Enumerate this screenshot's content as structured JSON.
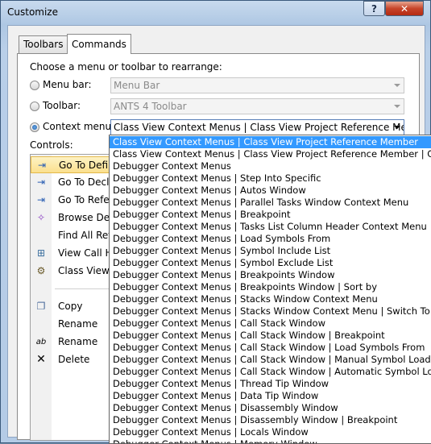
{
  "window": {
    "title": "Customize",
    "help_label": "?",
    "close_label": "✕"
  },
  "tabs": [
    {
      "label": "Toolbars"
    },
    {
      "label": "Commands"
    }
  ],
  "prompt": "Choose a menu or toolbar to rearrange:",
  "options": {
    "menu_bar": {
      "label": "Menu bar:",
      "value": "Menu Bar",
      "selected": false
    },
    "toolbar": {
      "label": "Toolbar:",
      "value": "ANTS 4 Toolbar",
      "selected": false
    },
    "context_menu": {
      "label": "Context menu:",
      "value": "Class View Context Menus | Class View Project Reference Membe",
      "selected": true
    }
  },
  "controls_label": "Controls:",
  "controls": [
    {
      "icon": "goto-definition-icon",
      "glyph": "⇥",
      "label": "Go To Defin",
      "selected": true
    },
    {
      "icon": "goto-declaration-icon",
      "glyph": "⇥",
      "label": "Go To Decla"
    },
    {
      "icon": "goto-reference-icon",
      "glyph": "⇥",
      "label": "Go To Refer"
    },
    {
      "icon": "browse-definition-icon",
      "glyph": "✧",
      "label": "Browse Defi"
    },
    {
      "icon": "find-all-references-icon",
      "glyph": "",
      "label": "Find All Ref"
    },
    {
      "icon": "view-call-hierarchy-icon",
      "glyph": "⊞",
      "label": "View Call H"
    },
    {
      "icon": "class-view-icon",
      "glyph": "⚙",
      "label": "Class View F"
    },
    {
      "icon": "copy-icon",
      "glyph": "❐",
      "label": "Copy"
    },
    {
      "icon": "",
      "glyph": "",
      "label": "Rename"
    },
    {
      "icon": "rename-icon",
      "glyph": "ab",
      "label": "Rename"
    },
    {
      "icon": "delete-icon",
      "glyph": "✕",
      "label": "Delete"
    }
  ],
  "dropdown_items": [
    "Class View Context Menus | Class View Project Reference Member",
    "Class View Context Menus | Class View Project Reference Member | Call Bro",
    "Debugger Context Menus",
    "Debugger Context Menus | Step Into Specific",
    "Debugger Context Menus | Autos Window",
    "Debugger Context Menus | Parallel Tasks Window Context Menu",
    "Debugger Context Menus | Breakpoint",
    "Debugger Context Menus | Tasks List Column Header Context Menu",
    "Debugger Context Menus | Load Symbols From",
    "Debugger Context Menus | Symbol Include List",
    "Debugger Context Menus | Symbol Exclude List",
    "Debugger Context Menus | Breakpoints Window",
    "Debugger Context Menus | Breakpoints Window | Sort by",
    "Debugger Context Menus | Stacks Window Context Menu",
    "Debugger Context Menus | Stacks Window Context Menu | Switch To Frame",
    "Debugger Context Menus | Call Stack Window",
    "Debugger Context Menus | Call Stack Window | Breakpoint",
    "Debugger Context Menus | Call Stack Window | Load Symbols From",
    "Debugger Context Menus | Call Stack Window | Manual Symbol Load Settin",
    "Debugger Context Menus | Call Stack Window | Automatic Symbol Load Set",
    "Debugger Context Menus | Thread Tip Window",
    "Debugger Context Menus | Data Tip Window",
    "Debugger Context Menus | Disassembly Window",
    "Debugger Context Menus | Disassembly Window | Breakpoint",
    "Debugger Context Menus | Locals Window",
    "Debugger Context Menus | Memory Window"
  ],
  "dropdown_selected_index": 0
}
